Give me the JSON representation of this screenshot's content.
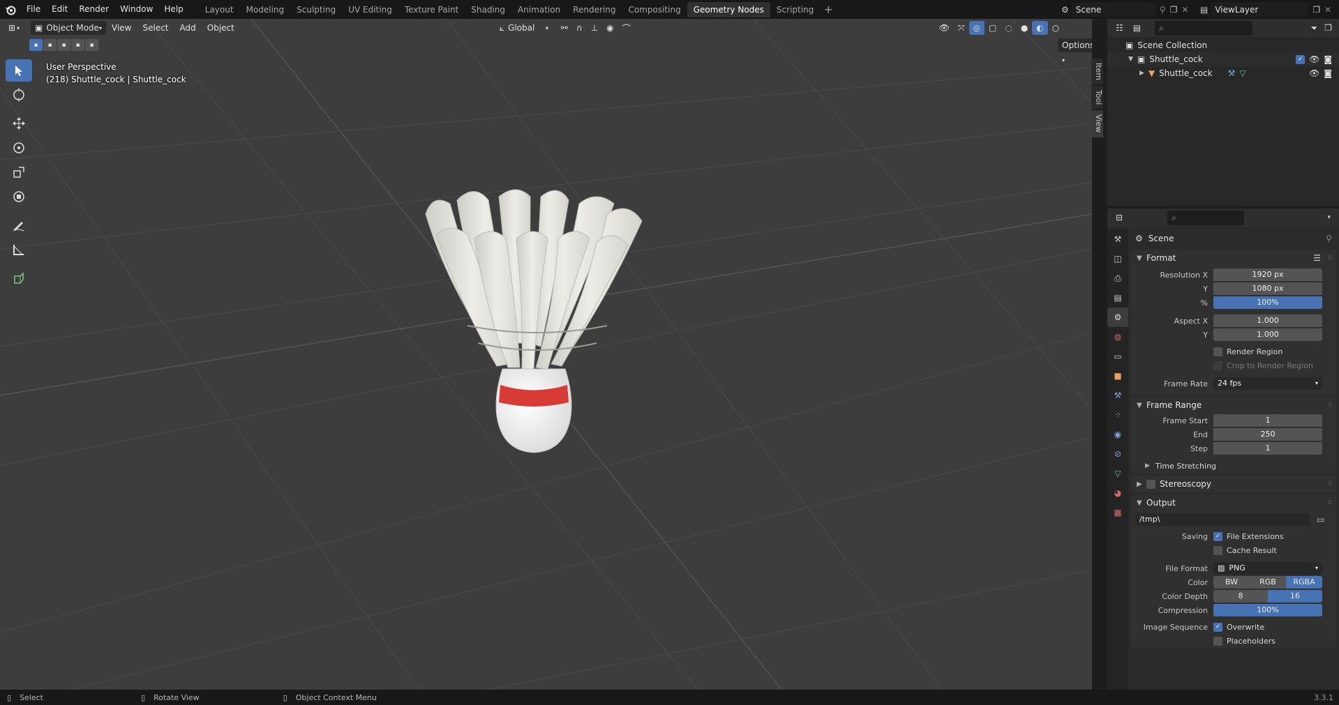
{
  "topbar": {
    "menus": [
      "File",
      "Edit",
      "Render",
      "Window",
      "Help"
    ],
    "workspaces": [
      "Layout",
      "Modeling",
      "Sculpting",
      "UV Editing",
      "Texture Paint",
      "Shading",
      "Animation",
      "Rendering",
      "Compositing",
      "Geometry Nodes",
      "Scripting"
    ],
    "active_workspace": "Geometry Nodes",
    "scene": "Scene",
    "view_layer": "ViewLayer"
  },
  "viewport": {
    "mode": "Object Mode",
    "menus": [
      "View",
      "Select",
      "Add",
      "Object"
    ],
    "orientation": "Global",
    "options": "Options",
    "perspective": "User Perspective",
    "object_info": "(218) Shuttle_cock | Shuttle_cock",
    "side_tabs": [
      "Item",
      "Tool",
      "View"
    ]
  },
  "outliner": {
    "root": "Scene Collection",
    "collection": "Shuttle_cock",
    "object": "Shuttle_cock"
  },
  "properties": {
    "context": "Scene",
    "format": {
      "title": "Format",
      "resolution_x_label": "Resolution X",
      "resolution_x": "1920 px",
      "y_label": "Y",
      "resolution_y": "1080 px",
      "pct_label": "%",
      "resolution_pct": "100%",
      "aspect_x_label": "Aspect X",
      "aspect_x": "1.000",
      "aspect_y": "1.000",
      "render_region": "Render Region",
      "crop_region": "Crop to Render Region",
      "frame_rate_label": "Frame Rate",
      "frame_rate": "24 fps"
    },
    "frame_range": {
      "title": "Frame Range",
      "start_label": "Frame Start",
      "start": "1",
      "end_label": "End",
      "end": "250",
      "step_label": "Step",
      "step": "1"
    },
    "time_stretching": "Time Stretching",
    "stereoscopy": "Stereoscopy",
    "output": {
      "title": "Output",
      "path": "/tmp\\",
      "saving_label": "Saving",
      "file_extensions": "File Extensions",
      "cache_result": "Cache Result",
      "file_format_label": "File Format",
      "file_format": "PNG",
      "color_label": "Color",
      "color_options": [
        "BW",
        "RGB",
        "RGBA"
      ],
      "color_active": "RGBA",
      "depth_label": "Color Depth",
      "depth_options": [
        "8",
        "16"
      ],
      "depth_active": "16",
      "compression_label": "Compression",
      "compression": "100%",
      "image_seq_label": "Image Sequence",
      "overwrite": "Overwrite",
      "placeholders": "Placeholders"
    }
  },
  "statusbar": {
    "items": [
      "Select",
      "Rotate View",
      "Object Context Menu"
    ],
    "version": "3.3.1"
  },
  "colors": {
    "accent": "#4772b3",
    "viewport_bg": "#3d3d3d",
    "panel_bg": "#303030",
    "shuttle_band": "#d83a35"
  }
}
